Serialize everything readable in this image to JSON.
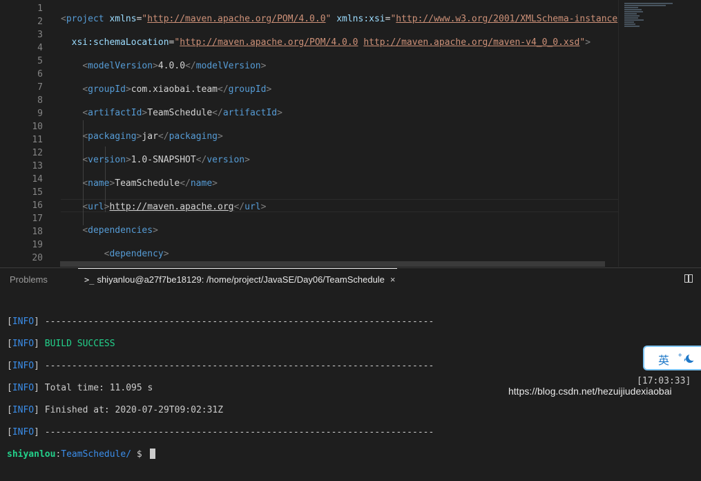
{
  "editor": {
    "line_numbers": [
      "1",
      "2",
      "3",
      "4",
      "5",
      "6",
      "7",
      "8",
      "9",
      "10",
      "11",
      "12",
      "13",
      "14",
      "15",
      "16",
      "17",
      "18",
      "19",
      "20"
    ]
  },
  "panel": {
    "tab_problems": "Problems",
    "tab_terminal_prompt_glyph": ">_",
    "tab_terminal": "shiyanlou@a27f7be18129: /home/project/JavaSE/Day06/TeamSchedule",
    "tab_close": "×"
  },
  "terminal": {
    "info_tag": "INFO",
    "separator": "------------------------------------------------------------------------",
    "build_success": "BUILD SUCCESS",
    "total_time": "Total time: 11.095 s",
    "finished_at": "Finished at: 2020-07-29T09:02:31Z",
    "prompt_user": "shiyanlou",
    "prompt_sep": ":",
    "prompt_path": "TeamSchedule/",
    "prompt_symbol": " $ ",
    "clock": "[17:03:33]"
  },
  "overlay": {
    "watermark": "https://blog.csdn.net/hezuijiudexiaobai",
    "ime_char": "英",
    "ime_punct": "°,"
  }
}
